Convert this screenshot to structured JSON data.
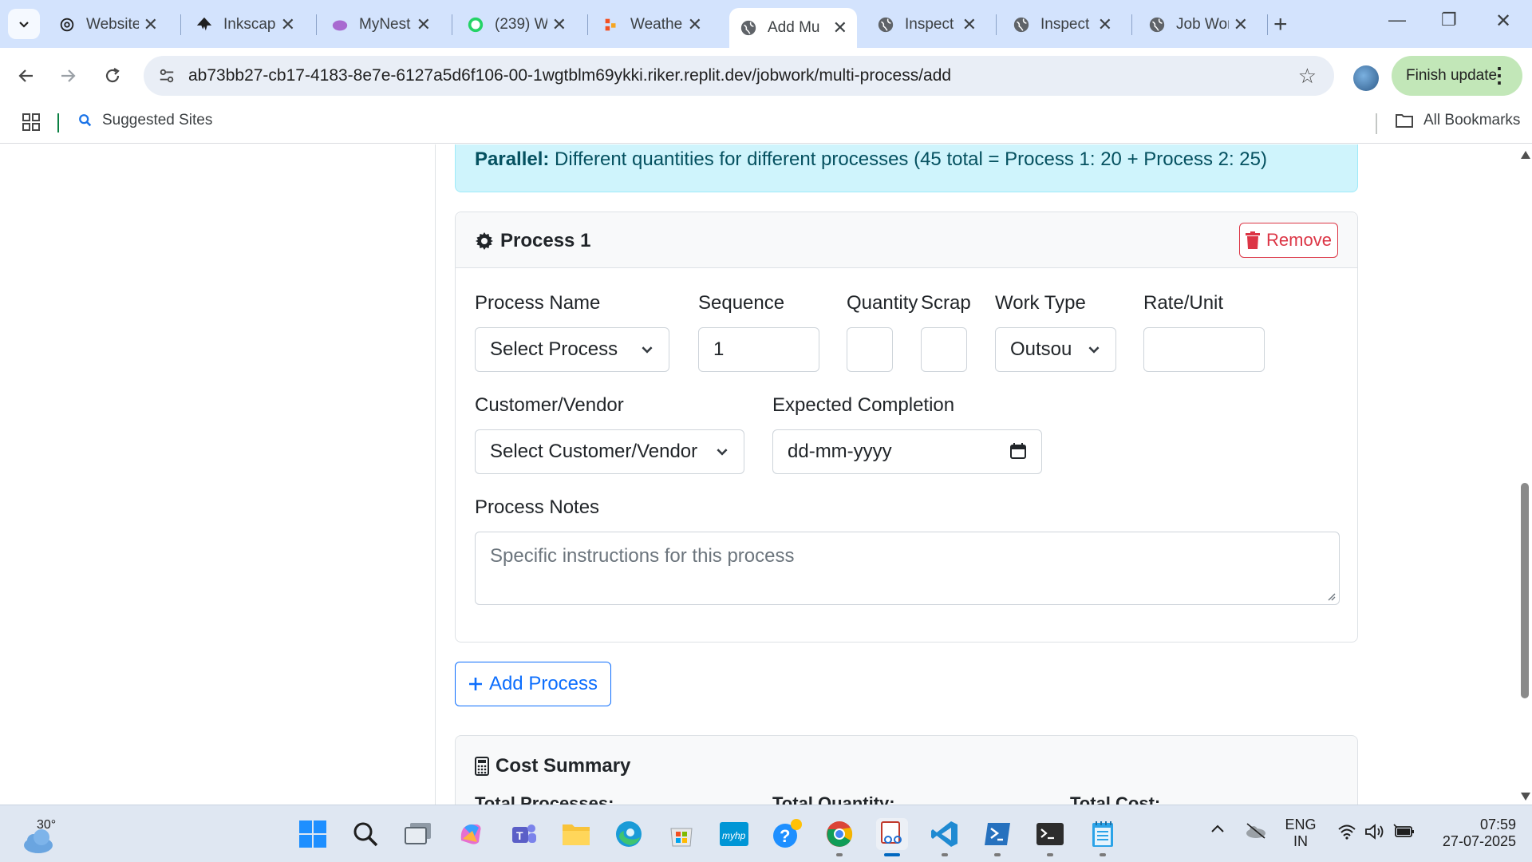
{
  "browser": {
    "tabs": [
      {
        "title": "Website",
        "icon": "openai-icon"
      },
      {
        "title": "Inkscape",
        "icon": "inkscape-icon"
      },
      {
        "title": "MyNest",
        "icon": "mynest-icon"
      },
      {
        "title": "(239) W",
        "icon": "whatsapp-icon"
      },
      {
        "title": "Weather",
        "icon": "weather-icon"
      },
      {
        "title": "Add Mu",
        "icon": "globe-icon",
        "active": true
      },
      {
        "title": "Inspect",
        "icon": "globe-icon"
      },
      {
        "title": "Inspect",
        "icon": "globe-icon"
      },
      {
        "title": "Job Wor",
        "icon": "globe-icon"
      }
    ],
    "url": "ab73bb27-cb17-4183-8e7e-6127a5d6f106-00-1wgtblm69ykki.riker.replit.dev/jobwork/multi-process/add",
    "finish_update": "Finish update",
    "bookmarks": {
      "suggested": "Suggested Sites",
      "all": "All Bookmarks"
    }
  },
  "page": {
    "alert": {
      "bold": "Parallel:",
      "text": " Different quantities for different processes (45 total = Process 1: 20 + Process 2: 25)"
    },
    "process_card": {
      "title": "Process 1",
      "remove_label": "Remove",
      "fields": {
        "process_name_label": "Process Name",
        "process_name_value": "Select Process",
        "sequence_label": "Sequence",
        "sequence_value": "1",
        "quantity_label": "Quantity",
        "scrap_label": "Scrap",
        "work_type_label": "Work Type",
        "work_type_value": "Outsou",
        "rate_label": "Rate/Unit",
        "customer_label": "Customer/Vendor",
        "customer_value": "Select Customer/Vendor",
        "completion_label": "Expected Completion",
        "completion_placeholder": "dd-mm-yyyy",
        "notes_label": "Process Notes",
        "notes_placeholder": "Specific instructions for this process"
      }
    },
    "add_process_label": "Add Process",
    "cost_summary": {
      "title": "Cost Summary",
      "total_processes": "Total Processes:",
      "total_quantity": "Total Quantity:",
      "total_cost": "Total Cost:"
    }
  },
  "taskbar": {
    "temperature": "30°",
    "lang_top": "ENG",
    "lang_bottom": "IN",
    "time": "07:59",
    "date": "27-07-2025"
  }
}
